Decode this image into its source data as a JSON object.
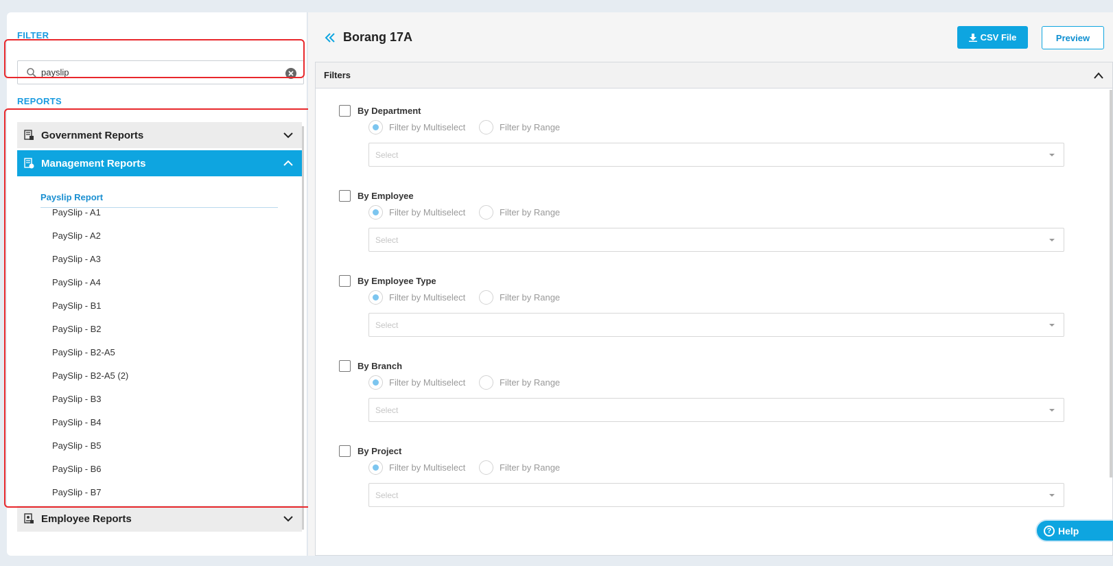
{
  "sidebar": {
    "filter_label": "FILTER",
    "search": {
      "value": "payslip"
    },
    "reports_label": "REPORTS",
    "groups": [
      {
        "title": "Government Reports",
        "icon": "government-report-icon",
        "expanded": false
      },
      {
        "title": "Management Reports",
        "icon": "management-report-icon",
        "expanded": true
      },
      {
        "title": "Employee Reports",
        "icon": "employee-report-icon",
        "expanded": false
      }
    ],
    "subsection_title": "Payslip Report",
    "items": [
      "PaySlip - A1",
      "PaySlip - A2",
      "PaySlip - A3",
      "PaySlip - A4",
      "PaySlip - B1",
      "PaySlip - B2",
      "PaySlip - B2-A5",
      "PaySlip - B2-A5 (2)",
      "PaySlip - B3",
      "PaySlip - B4",
      "PaySlip - B5",
      "PaySlip - B6",
      "PaySlip - B7"
    ]
  },
  "header": {
    "title": "Borang 17A",
    "csv_label": "CSV File",
    "preview_label": "Preview"
  },
  "filters": {
    "title": "Filters",
    "multiselect_label": "Filter by Multiselect",
    "range_label": "Filter by Range",
    "select_placeholder": "Select",
    "groups": [
      {
        "label": "By Department"
      },
      {
        "label": "By Employee"
      },
      {
        "label": "By Employee Type"
      },
      {
        "label": "By Branch"
      },
      {
        "label": "By Project"
      }
    ]
  },
  "help_label": "Help",
  "colors": {
    "accent": "#0ea5e0",
    "highlight": "#e8272b"
  }
}
